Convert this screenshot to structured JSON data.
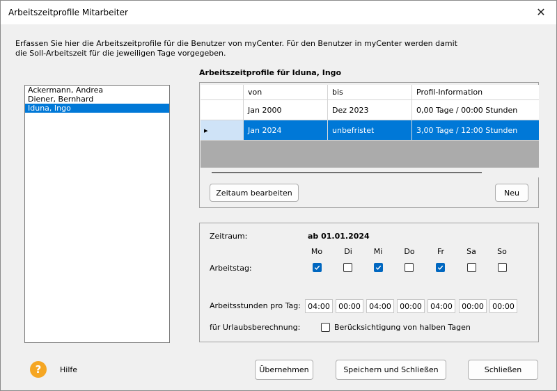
{
  "window": {
    "title": "Arbeitszeitprofile Mitarbeiter",
    "close_icon": "close-icon"
  },
  "intro_text": "Erfassen Sie hier die Arbeitszeitprofile für die Benutzer von myCenter. Für den Benutzer in myCenter werden damit die Soll-Arbeitszeit für die jeweiligen Tage vorgegeben.",
  "users": [
    "Ackermann, Andrea",
    "Diener, Bernhard",
    "Iduna, Ingo"
  ],
  "selected_user": "Iduna, Ingo",
  "profiles_title": "Arbeitszeitprofile für Iduna, Ingo",
  "grid": {
    "columns": [
      "von",
      "bis",
      "Profil-Information"
    ],
    "rows": [
      {
        "von": "Jan 2000",
        "bis": "Dez 2023",
        "info": "0,00 Tage / 00:00 Stunden",
        "selected": false
      },
      {
        "von": "Jan 2024",
        "bis": "unbefristet",
        "info": "3,00 Tage / 12:00 Stunden",
        "selected": true
      }
    ],
    "row_indicator": "▸"
  },
  "buttons": {
    "edit_period": "Zeitaum bearbeiten",
    "new": "Neu",
    "apply": "Übernehmen",
    "save_close": "Speichern und Schließen",
    "close": "Schließen"
  },
  "detail": {
    "period_label": "Zeitraum:",
    "period_value": "ab 01.01.2024",
    "days": [
      "Mo",
      "Di",
      "Mi",
      "Do",
      "Fr",
      "Sa",
      "So"
    ],
    "workday_label": "Arbeitstag:",
    "workdays_checked": [
      true,
      false,
      true,
      false,
      true,
      false,
      false
    ],
    "hours_label": "Arbeitsstunden pro Tag:",
    "hours": [
      "04:00",
      "00:00",
      "04:00",
      "00:00",
      "04:00",
      "00:00",
      "00:00"
    ],
    "vacation_label": "für Urlaubsberechnung:",
    "half_days_label": "Berücksichtigung von halben Tagen",
    "half_days_checked": false
  },
  "help": {
    "icon": "?",
    "label": "Hilfe",
    "color": "#f5a623"
  },
  "colors": {
    "selection": "#0078d7",
    "checkbox": "#0067c0"
  }
}
